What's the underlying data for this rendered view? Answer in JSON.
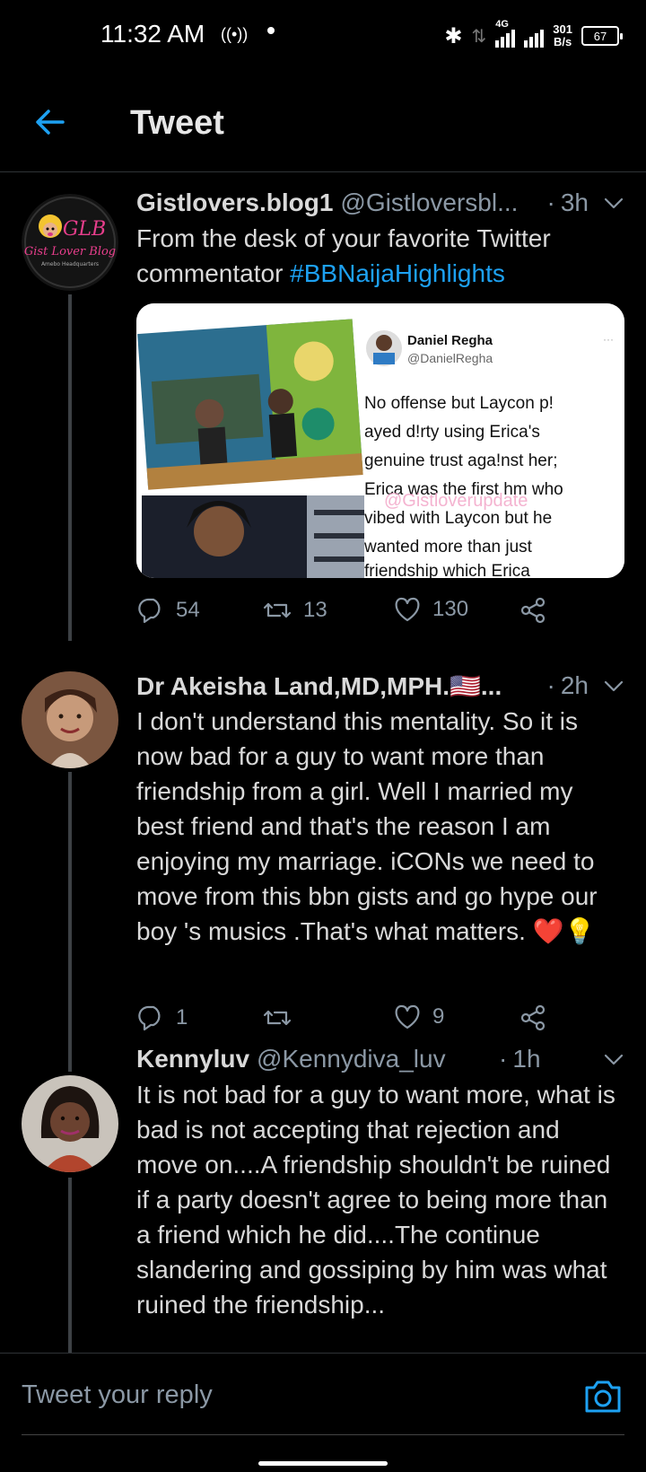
{
  "status_bar": {
    "time": "11:32 AM",
    "radio_glyph": "((•))",
    "network_label": "4G",
    "speed_value": "301",
    "speed_unit": "B/s",
    "battery": "67"
  },
  "header": {
    "title": "Tweet"
  },
  "tweets": [
    {
      "name": "Gistlovers.blog1",
      "handle": "@Gistloversbl...",
      "time": "3h",
      "text": "From the desk of your favorite Twitter commentator ",
      "hashtag": "#BBNaijaHighlights",
      "avatar_text": {
        "line1": "GLB",
        "line2": "Gist Lover Blog",
        "line3": "Amebo Headquarters"
      },
      "media": {
        "quoted_name": "Daniel Regha",
        "quoted_handle": "@DanielRegha",
        "quoted_text_lines": [
          "No offense but Laycon p!",
          "ayed d!rty using Erica's",
          "genuine trust aga!nst her;",
          "Erica was the first hm who",
          "vibed with Laycon but he",
          "wanted more than just",
          "friendship which Erica"
        ],
        "watermark": "@Gistloverupdate"
      },
      "replies": "54",
      "retweets": "13",
      "likes": "130"
    },
    {
      "name": "Dr Akeisha Land,MD,MPH.🇺🇸...",
      "handle": "",
      "time": "2h",
      "text": "I don't understand this mentality. So it is now bad for a guy to want more than friendship from a girl. Well I married my best friend and that's the reason I am enjoying my marriage. iCONs we need to move from this bbn gists and go hype our boy 's musics .That's what matters. ❤️💡",
      "replies": "1",
      "retweets": "",
      "likes": "9"
    },
    {
      "name": "Kennyluv",
      "handle": "@Kennydiva_luv",
      "time": "1h",
      "text": "It is not bad for a guy to want more, what is bad is not accepting that rejection and move on....A friendship shouldn't be ruined if a party doesn't agree to being more than a friend which he did....The continue slandering and gossiping by him was what ruined the friendship..."
    }
  ],
  "reply_bar": {
    "placeholder": "Tweet your reply"
  },
  "colors": {
    "accent": "#1da1f2",
    "background": "#000000",
    "secondary_text": "#8b98a5",
    "primary_text": "#d9d9d9"
  }
}
